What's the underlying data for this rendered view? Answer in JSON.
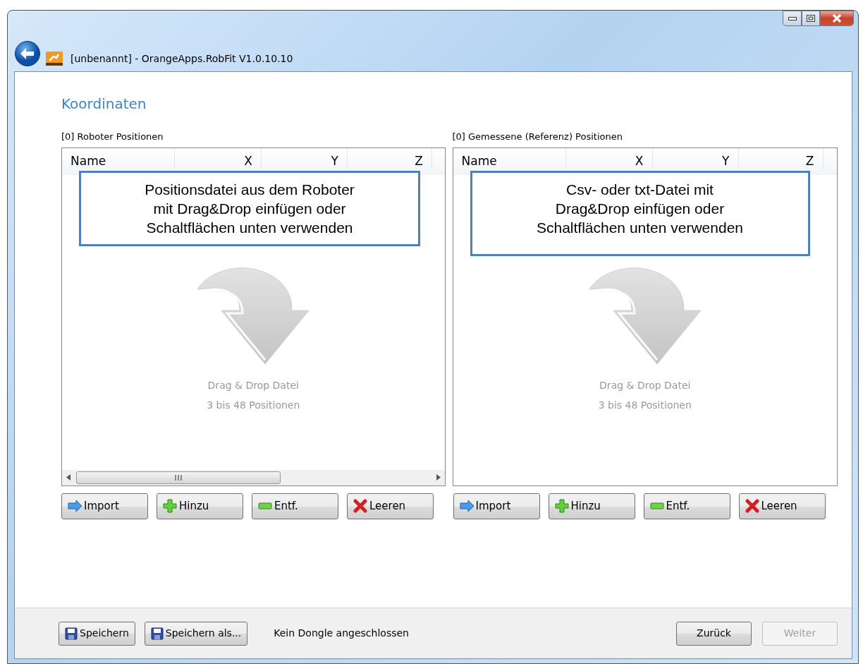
{
  "window": {
    "title": "[unbenannt] - OrangeApps.RobFit V1.0.10.10"
  },
  "page_title": "Koordinaten",
  "panels": [
    {
      "label": "[0] Roboter Positionen",
      "columns": [
        "Name",
        "X",
        "Y",
        "Z"
      ],
      "callout": [
        "Positionsdatei aus dem Roboter",
        "mit Drag&Drop einfügen oder",
        "Schaltflächen unten verwenden"
      ],
      "drop_hint": "Drag & Drop Datei",
      "drop_range": "3 bis 48 Positionen",
      "scrollbar": true,
      "buttons": [
        {
          "label": "Import",
          "kind": "import"
        },
        {
          "label": "Hinzu",
          "kind": "add"
        },
        {
          "label": "Entf.",
          "kind": "remove"
        },
        {
          "label": "Leeren",
          "kind": "clear"
        }
      ]
    },
    {
      "label": "[0] Gemessene (Referenz) Positionen",
      "columns": [
        "Name",
        "X",
        "Y",
        "Z"
      ],
      "callout": [
        "Csv- oder txt-Datei mit",
        "Drag&Drop einfügen oder",
        "Schaltflächen unten verwenden"
      ],
      "drop_hint": "Drag & Drop Datei",
      "drop_range": "3 bis 48 Positionen",
      "scrollbar": false,
      "buttons": [
        {
          "label": "Import",
          "kind": "import"
        },
        {
          "label": "Hinzu",
          "kind": "add"
        },
        {
          "label": "Entf.",
          "kind": "remove"
        },
        {
          "label": "Leeren",
          "kind": "clear"
        }
      ]
    }
  ],
  "footer": {
    "buttons": [
      {
        "label": "Speichern",
        "kind": "save"
      },
      {
        "label": "Speichern als...",
        "kind": "save"
      }
    ],
    "status": "Kein Dongle angeschlossen",
    "nav": [
      {
        "label": "Zurück",
        "disabled": false
      },
      {
        "label": "Weiter",
        "disabled": true
      }
    ]
  }
}
